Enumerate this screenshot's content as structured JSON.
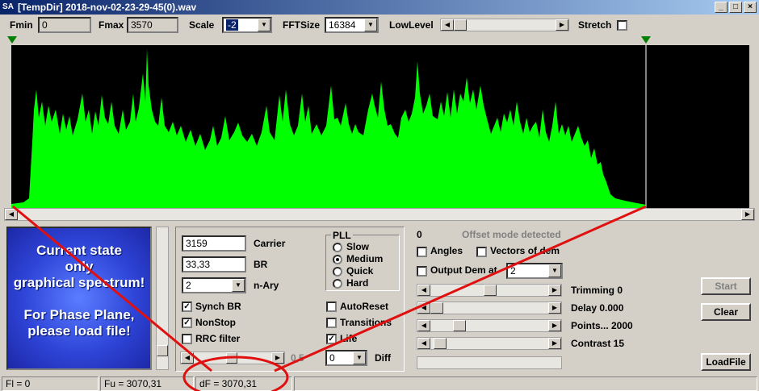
{
  "title": "[TempDir] 2018-nov-02-23-29-45(0).wav",
  "app_icon": "SA",
  "window_buttons": {
    "minimize": "_",
    "maximize": "□",
    "close": "×"
  },
  "toolbar": {
    "fmin_label": "Fmin",
    "fmin_value": "0",
    "fmax_label": "Fmax",
    "fmax_value": "3570",
    "scale_label": "Scale",
    "scale_value": "-2",
    "fftsize_label": "FFTSize",
    "fftsize_value": "16384",
    "lowlevel_label": "LowLevel",
    "stretch_label": "Stretch"
  },
  "info_text": {
    "line1": "Current state",
    "line2": "only",
    "line3": "graphical spectrum!",
    "line4": "For Phase Plane,",
    "line5": "please load file!"
  },
  "params": {
    "carrier_value": "3159",
    "carrier_label": "Carrier",
    "br_value": "33,33",
    "br_label": "BR",
    "nary_value": "2",
    "nary_label": "n-Ary",
    "synch_br_label": "Synch BR",
    "nonstop_label": "NonStop",
    "rrc_label": "RRC filter",
    "slider_value": "0,5"
  },
  "pll": {
    "title": "PLL",
    "options": [
      "Slow",
      "Medium",
      "Quick",
      "Hard"
    ],
    "selected": "Medium"
  },
  "options": {
    "autoreset_label": "AutoReset",
    "transitions_label": "Transitions",
    "life_label": "Life",
    "diff_value": "0",
    "diff_label": "Diff"
  },
  "right": {
    "counter": "0",
    "offset_status": "Offset mode detected",
    "angles_label": "Angles",
    "vectors_label": "Vectors of dem",
    "output_dem_label": "Output Dem at",
    "output_dem_value": "2",
    "trimming_label": "Trimming 0",
    "delay_label": "Delay  0.000",
    "points_label": "Points... 2000",
    "contrast_label": "Contrast 15"
  },
  "buttons": {
    "start": "Start",
    "clear": "Clear",
    "loadfile": "LoadFile"
  },
  "status": {
    "fl": "Fl = 0",
    "fu": "Fu = 3070,31",
    "df": "dF = 3070,31"
  },
  "colors": {
    "spectrum": "#00ff00",
    "marker": "#008000",
    "annotation": "#e01010",
    "info_bg": "#2f45d8"
  }
}
